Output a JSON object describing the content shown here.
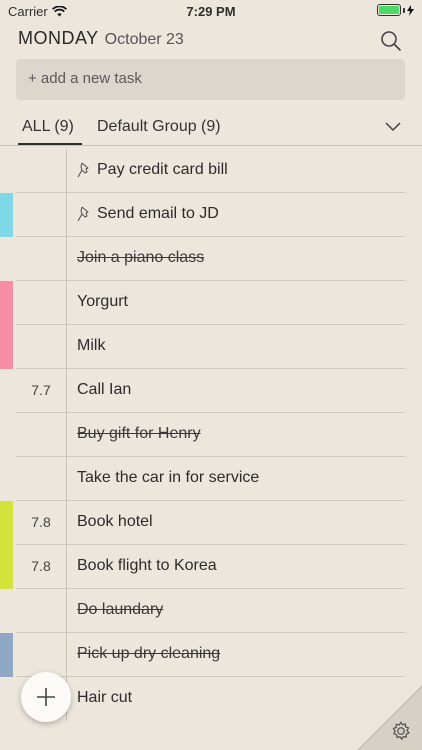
{
  "status_bar": {
    "carrier": "Carrier",
    "time": "7:29 PM"
  },
  "header": {
    "day": "MONDAY",
    "date": "October 23"
  },
  "add_task": {
    "placeholder": "+ add a new task"
  },
  "tabs": [
    {
      "label": "ALL (9)",
      "active": true
    },
    {
      "label": "Default Group (9)",
      "active": false
    }
  ],
  "tasks": [
    {
      "text": "Pay credit card bill",
      "due": "",
      "done": false,
      "pinned": true,
      "tag_color": ""
    },
    {
      "text": "Send email to JD",
      "due": "",
      "done": false,
      "pinned": true,
      "tag_color": "#7fd8e6"
    },
    {
      "text": "Join a piano class",
      "due": "",
      "done": true,
      "pinned": false,
      "tag_color": ""
    },
    {
      "text": "Yorgurt",
      "due": "",
      "done": false,
      "pinned": false,
      "tag_color": "#f78da7"
    },
    {
      "text": "Milk",
      "due": "",
      "done": false,
      "pinned": false,
      "tag_color": "#f78da7"
    },
    {
      "text": "Call Ian",
      "due": "7.7",
      "done": false,
      "pinned": false,
      "tag_color": ""
    },
    {
      "text": "Buy gift for Henry",
      "due": "",
      "done": true,
      "pinned": false,
      "tag_color": ""
    },
    {
      "text": "Take the car in for service",
      "due": "",
      "done": false,
      "pinned": false,
      "tag_color": ""
    },
    {
      "text": "Book hotel",
      "due": "7.8",
      "done": false,
      "pinned": false,
      "tag_color": "#d4e33b"
    },
    {
      "text": "Book flight to Korea",
      "due": "7.8",
      "done": false,
      "pinned": false,
      "tag_color": "#d4e33b"
    },
    {
      "text": "Do laundary",
      "due": "",
      "done": true,
      "pinned": false,
      "tag_color": ""
    },
    {
      "text": "Pick up dry cleaning",
      "due": "",
      "done": true,
      "pinned": false,
      "tag_color": "#8ea7c4"
    },
    {
      "text": "Hair cut",
      "due": "",
      "done": false,
      "pinned": false,
      "tag_color": ""
    }
  ],
  "icons": {
    "search": "search-icon",
    "chevron": "chevron-down-icon",
    "pin": "pin-icon",
    "add": "plus-icon",
    "settings": "gear-icon",
    "wifi": "wifi-icon",
    "battery": "battery-icon"
  }
}
